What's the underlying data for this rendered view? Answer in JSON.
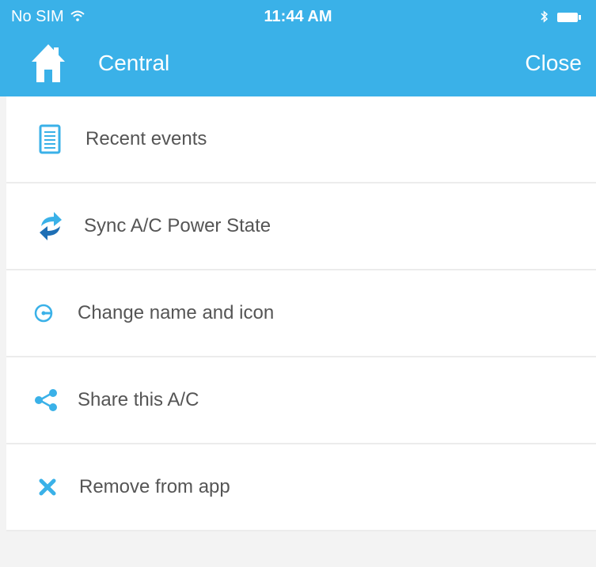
{
  "status": {
    "carrier": "No SIM",
    "time": "11:44 AM",
    "wifi_icon": "wifi-icon",
    "bluetooth_icon": "bluetooth-icon",
    "battery_icon": "battery-icon"
  },
  "header": {
    "title": "Central",
    "close_label": "Close",
    "home_icon": "home-icon"
  },
  "menu": {
    "items": [
      {
        "label": "Recent events",
        "icon": "document-list-icon"
      },
      {
        "label": "Sync A/C Power State",
        "icon": "sync-icon"
      },
      {
        "label": "Change name and icon",
        "icon": "edit-circle-icon"
      },
      {
        "label": "Share this A/C",
        "icon": "share-icon"
      },
      {
        "label": "Remove from app",
        "icon": "close-x-icon"
      }
    ]
  },
  "colors": {
    "accent": "#3ab1e8",
    "background": "#f3f3f3",
    "text": "#555555"
  }
}
